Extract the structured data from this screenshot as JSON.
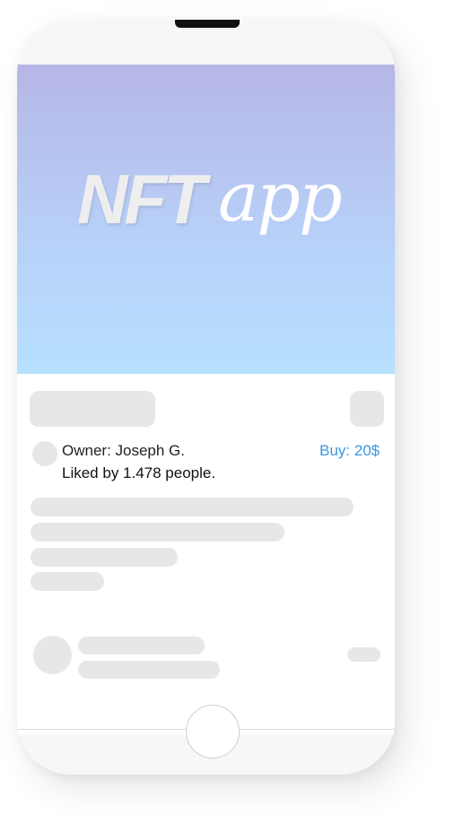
{
  "logo": {
    "part1": "NFT",
    "part2": "app"
  },
  "post": {
    "owner": "Owner: Joseph G.",
    "liked": "Liked by 1.478 people.",
    "buy": "Buy: 20$"
  },
  "colors": {
    "hero_top": "#b6b6e6",
    "hero_bottom": "#b7e0ff",
    "buy_accent": "#3b97e3",
    "skeleton": "#e7e7e7"
  }
}
